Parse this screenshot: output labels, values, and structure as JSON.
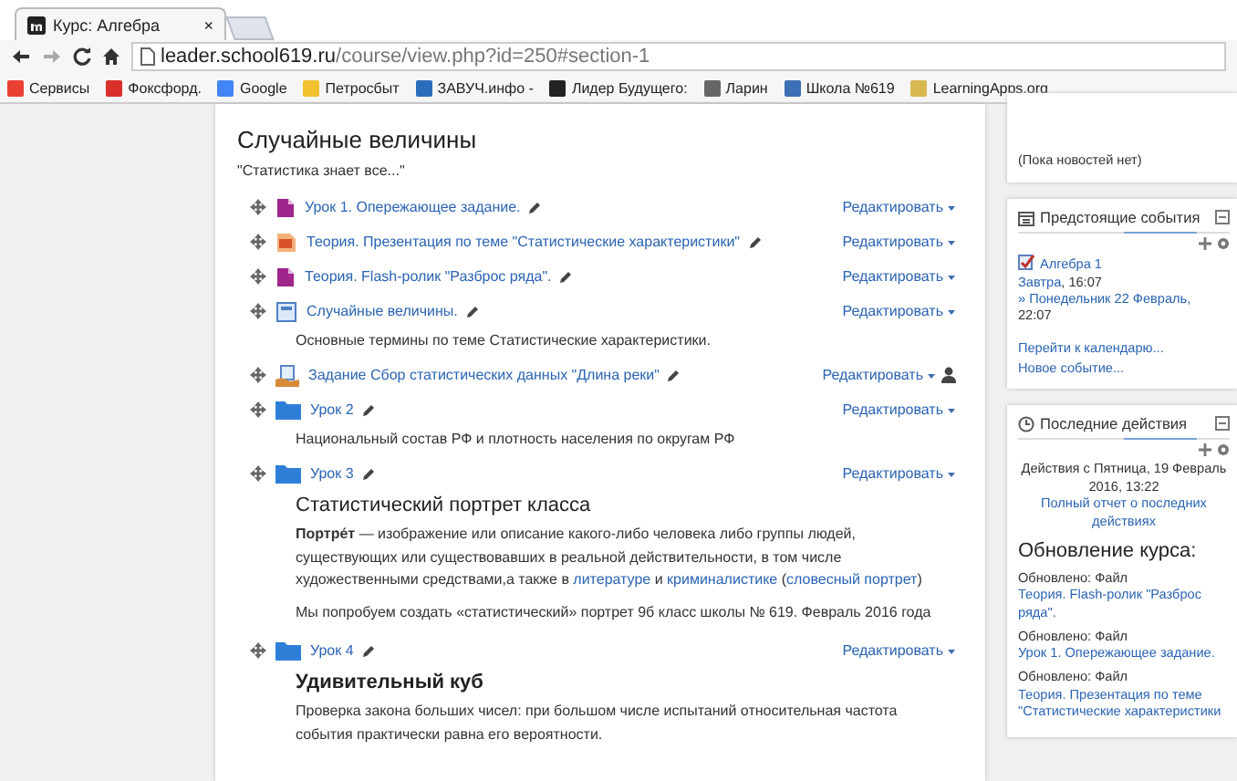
{
  "browser": {
    "tab_title": "Курс: Алгебра",
    "tab_close": "×",
    "url_host": "leader.school619.ru",
    "url_path": "/course/view.php?id=250#section-1",
    "bookmarks": [
      {
        "label": "Сервисы",
        "color": "#e94235"
      },
      {
        "label": "Фоксфорд.",
        "color": "#d9302c"
      },
      {
        "label": "Google",
        "color": "#4285f4"
      },
      {
        "label": "Петросбыт",
        "color": "#f2c230"
      },
      {
        "label": "ЗАВУЧ.инфо -",
        "color": "#2a6ebb"
      },
      {
        "label": "Лидер Будущего:",
        "color": "#222222"
      },
      {
        "label": "Ларин",
        "color": "#666666"
      },
      {
        "label": "Школа №619",
        "color": "#3d6fb5"
      },
      {
        "label": "LearningApps.org",
        "color": "#d8b850"
      }
    ]
  },
  "section": {
    "title": "Случайные величины",
    "summary": "\"Статистика знает все...\"",
    "items": [
      {
        "kind": "file",
        "title": "Урок 1. Опережающее задание.",
        "edit": "Редактировать"
      },
      {
        "kind": "presentation",
        "title": "Теория. Презентация по теме \"Статистические характеристики\"",
        "edit": "Редактировать"
      },
      {
        "kind": "file",
        "title": "Теория. Flash-ролик \"Разброс ряда\".",
        "edit": "Редактировать"
      },
      {
        "kind": "page",
        "title": "Случайные величины.",
        "edit": "Редактировать",
        "description": "Основные термины по теме Статистические характеристики."
      },
      {
        "kind": "assign",
        "title": "Задание Сбор статистических данных \"Длина реки\"",
        "edit": "Редактировать"
      },
      {
        "kind": "folder",
        "title": "Урок 2",
        "edit": "Редактировать",
        "description": "Национальный состав РФ и плотность населения по округам РФ"
      },
      {
        "kind": "folder",
        "title": "Урок 3",
        "edit": "Редактировать",
        "content": [
          {
            "kind": "heading",
            "text": "Статистический портрет класса"
          },
          {
            "kind": "paragraph",
            "parts": [
              {
                "kind": "bold",
                "text": "Портре́т"
              },
              {
                "kind": "text",
                "text": " — изображение или описание какого-либо человека либо группы людей, существующих или существовавших в реальной действительности, в том числе художественными средствами,а также в "
              },
              {
                "kind": "link",
                "text": "литературе"
              },
              {
                "kind": "text",
                "text": " и "
              },
              {
                "kind": "link",
                "text": "криминалистике"
              },
              {
                "kind": "text",
                "text": " ("
              },
              {
                "kind": "link",
                "text": "словесный портрет"
              },
              {
                "kind": "text",
                "text": ")"
              }
            ]
          },
          {
            "kind": "paragraph",
            "parts": [
              {
                "kind": "text",
                "text": "Мы попробуем создать «статистический» портрет 9б класс школы № 619. Февраль 2016 года"
              }
            ]
          }
        ]
      },
      {
        "kind": "folder",
        "title": "Урок 4",
        "edit": "Редактировать",
        "content": [
          {
            "kind": "strong_heading",
            "text": "Удивительный  куб"
          },
          {
            "kind": "paragraph",
            "parts": [
              {
                "kind": "text",
                "text": "Проверка закона больших чисел: при большом числе испытаний относительная частота события практически равна его вероятности."
              }
            ]
          }
        ]
      }
    ]
  },
  "news": {
    "text": "(Пока новостей нет)"
  },
  "events": {
    "title": "Предстоящие события",
    "event": {
      "name": "Алгебра 1",
      "when": "Завтра",
      "time": ", 16:07",
      "until": "» Понедельник 22 Февраль,",
      "until_time": "22:07"
    },
    "links": [
      "Перейти к календарю...",
      "Новое событие..."
    ]
  },
  "recent": {
    "title": "Последние действия",
    "since": "Действия с Пятница, 19 Февраль 2016, 13:22",
    "report": "Полный отчет о последних действиях",
    "heading": "Обновление курса:",
    "updates": [
      {
        "label": "Обновлено: Файл",
        "link": "Теория. Flash-ролик \"Разброс ряда\"."
      },
      {
        "label": "Обновлено: Файл",
        "link": "Урок 1. Опережающее задание."
      },
      {
        "label": "Обновлено: Файл",
        "link": "Теория. Презентация по теме \"Статистические характеристики"
      }
    ]
  }
}
